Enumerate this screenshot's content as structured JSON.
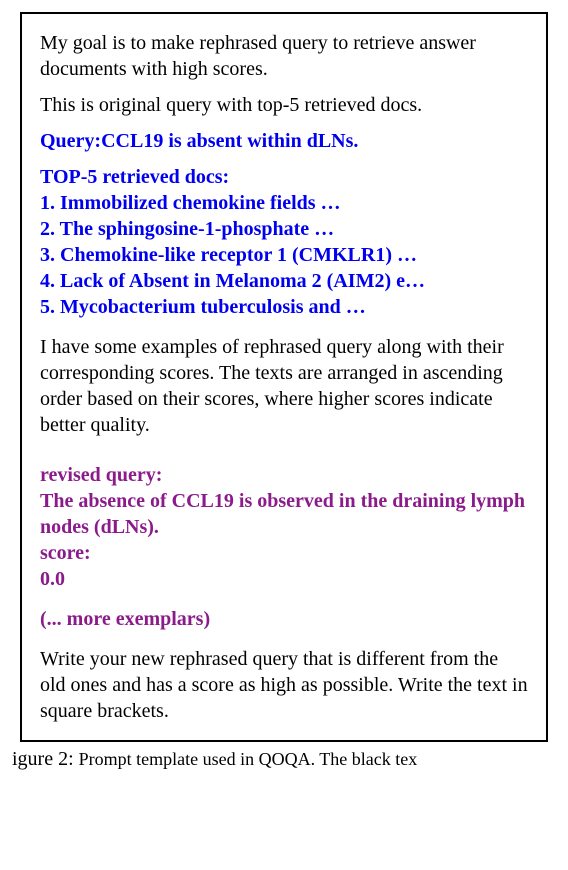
{
  "box": {
    "intro1": "My goal is to make rephrased query to retrieve answer documents with high scores.",
    "intro2": "This is original query with top-5 retrieved docs.",
    "query_label": "Query:",
    "query_text": "CCL19 is absent within dLNs.",
    "docs_label": "TOP-5 retrieved docs:",
    "docs": [
      "1. Immobilized chemokine fields …",
      "2. The sphingosine-1-phosphate …",
      "3. Chemokine-like receptor 1 (CMKLR1) …",
      "4. Lack of Absent in Melanoma 2 (AIM2) e…",
      "5. Mycobacterium tuberculosis and …"
    ],
    "explain": "I have some examples of rephrased query along with their corresponding scores. The texts are arranged in ascending order based on their scores, where higher scores indicate better quality.",
    "revised_label": "revised query:",
    "revised_text": "The absence of CCL19 is observed in the draining lymph nodes (dLNs).",
    "score_label": "score:",
    "score_value": "0.0",
    "more_exemplars": "(... more exemplars)",
    "final": "Write your new rephrased query that is different from the old ones and has a score as high as possible. Write the text in square brackets."
  },
  "caption": {
    "fig_label": "igure 2: ",
    "text": "Prompt template used in QOQA. The black tex"
  }
}
